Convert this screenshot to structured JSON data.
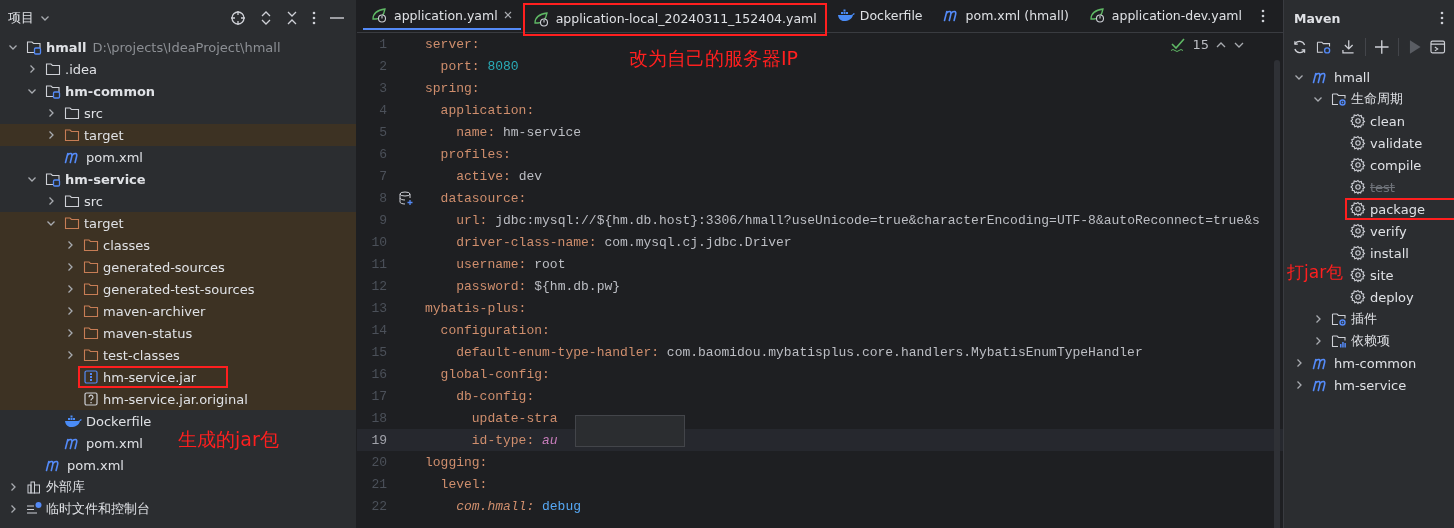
{
  "project_panel": {
    "title": "项目",
    "tree": [
      {
        "name": "hmall",
        "kind": "module",
        "path": "D:\\projects\\IdeaProject\\hmall",
        "expanded": true,
        "children": [
          {
            "name": ".idea",
            "kind": "folder",
            "expanded": false
          },
          {
            "name": "hm-common",
            "kind": "module",
            "expanded": true,
            "children": [
              {
                "name": "src",
                "kind": "folder",
                "expanded": false
              },
              {
                "name": "target",
                "kind": "folder",
                "excluded": true,
                "expanded": false
              },
              {
                "name": "pom.xml",
                "kind": "maven"
              }
            ]
          },
          {
            "name": "hm-service",
            "kind": "module",
            "expanded": true,
            "children": [
              {
                "name": "src",
                "kind": "folder",
                "expanded": false
              },
              {
                "name": "target",
                "kind": "folder",
                "excluded": true,
                "expanded": true,
                "children": [
                  {
                    "name": "classes",
                    "kind": "folder",
                    "expanded": false
                  },
                  {
                    "name": "generated-sources",
                    "kind": "folder",
                    "expanded": false
                  },
                  {
                    "name": "generated-test-sources",
                    "kind": "folder",
                    "expanded": false
                  },
                  {
                    "name": "maven-archiver",
                    "kind": "folder",
                    "expanded": false
                  },
                  {
                    "name": "maven-status",
                    "kind": "folder",
                    "expanded": false
                  },
                  {
                    "name": "test-classes",
                    "kind": "folder",
                    "expanded": false
                  },
                  {
                    "name": "hm-service.jar",
                    "kind": "jar",
                    "boxed": true
                  },
                  {
                    "name": "hm-service.jar.original",
                    "kind": "unknown"
                  }
                ]
              },
              {
                "name": "Dockerfile",
                "kind": "docker"
              },
              {
                "name": "pom.xml",
                "kind": "maven"
              }
            ]
          },
          {
            "name": "pom.xml",
            "kind": "maven"
          }
        ]
      },
      {
        "name": "外部库",
        "kind": "library",
        "expanded": false
      },
      {
        "name": "临时文件和控制台",
        "kind": "scratches",
        "expanded": false
      }
    ]
  },
  "editor": {
    "tabs": [
      {
        "label": "application.yaml",
        "kind": "spring",
        "selected": true,
        "closable": true
      },
      {
        "label": "application-local_20240311_152404.yaml",
        "kind": "spring",
        "selected": false,
        "boxed": true
      },
      {
        "label": "Dockerfile",
        "kind": "docker",
        "selected": false
      },
      {
        "label": "pom.xml (hmall)",
        "kind": "maven",
        "selected": false
      },
      {
        "label": "application-dev.yaml",
        "kind": "spring",
        "selected": false
      }
    ],
    "inspection_count": "15",
    "lines": [
      {
        "number": "1",
        "key": "server:"
      },
      {
        "number": "2",
        "key": "  port:",
        "value": " 8080",
        "kind": "number"
      },
      {
        "number": "3",
        "key": "spring:"
      },
      {
        "number": "4",
        "key": "  application:"
      },
      {
        "number": "5",
        "key": "    name:",
        "value": " hm-service"
      },
      {
        "number": "6",
        "key": "  profiles:"
      },
      {
        "number": "7",
        "key": "    active:",
        "value": " dev"
      },
      {
        "number": "8",
        "key": "  datasource:",
        "has_gutter_icon": true
      },
      {
        "number": "9",
        "key": "    url:",
        "value": " jdbc:mysql://${hm.db.host}:3306/hmall?useUnicode=true&characterEncoding=UTF-8&autoReconnect=true&s"
      },
      {
        "number": "10",
        "key": "    driver-class-name:",
        "value": " com.mysql.cj.jdbc.Driver"
      },
      {
        "number": "11",
        "key": "    username:",
        "value": " root"
      },
      {
        "number": "12",
        "key": "    password:",
        "value": " ${hm.db.pw}"
      },
      {
        "number": "13",
        "key": "mybatis-plus:"
      },
      {
        "number": "14",
        "key": "  configuration:"
      },
      {
        "number": "15",
        "key": "    default-enum-type-handler:",
        "value": " com.baomidou.mybatisplus.core.handlers.MybatisEnumTypeHandler"
      },
      {
        "number": "16",
        "key": "  global-config:"
      },
      {
        "number": "17",
        "key": "    db-config:"
      },
      {
        "number": "18",
        "key": "      update-stra"
      },
      {
        "number": "19",
        "key": "      id-type:",
        "value": " au",
        "kind": "constant",
        "current": true
      },
      {
        "number": "20",
        "key": "logging:"
      },
      {
        "number": "21",
        "key": "  level:"
      },
      {
        "number": "22",
        "key": "    com.hmall:",
        "italic_key": true,
        "value": " debug",
        "kind": "keyword"
      }
    ]
  },
  "maven_panel": {
    "title": "Maven",
    "tree": [
      {
        "name": "hmall",
        "kind": "project",
        "expanded": true,
        "children": [
          {
            "name": "生命周期",
            "kind": "lifecycle",
            "expanded": true,
            "children": [
              {
                "name": "clean",
                "kind": "goal"
              },
              {
                "name": "validate",
                "kind": "goal"
              },
              {
                "name": "compile",
                "kind": "goal"
              },
              {
                "name": "test",
                "kind": "goal",
                "disabled": true
              },
              {
                "name": "package",
                "kind": "goal",
                "boxed": true
              },
              {
                "name": "verify",
                "kind": "goal"
              },
              {
                "name": "install",
                "kind": "goal"
              },
              {
                "name": "site",
                "kind": "goal"
              },
              {
                "name": "deploy",
                "kind": "goal"
              }
            ]
          },
          {
            "name": "插件",
            "kind": "plugins",
            "expanded": false
          },
          {
            "name": "依赖项",
            "kind": "dependencies",
            "expanded": false
          }
        ]
      },
      {
        "name": "hm-common",
        "kind": "project",
        "expanded": false
      },
      {
        "name": "hm-service",
        "kind": "project",
        "expanded": false
      }
    ]
  },
  "annotations": [
    {
      "text": "改为自己的服务器IP"
    },
    {
      "text": "生成的jar包"
    },
    {
      "text": "打jar包"
    }
  ]
}
